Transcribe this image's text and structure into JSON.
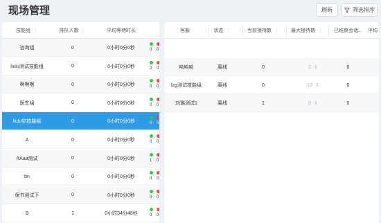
{
  "header": {
    "title": "现场管理",
    "refresh_label": "刷新",
    "filter_label": "筛选排序"
  },
  "left_table": {
    "columns": [
      "技能组",
      "排队人数",
      "平均等待时长"
    ],
    "rows": [
      {
        "name": "咨询组",
        "queue": "0",
        "wait": "0小时0分0秒",
        "online": "0",
        "offline": "0",
        "selected": false
      },
      {
        "name": "liulu测试技能组",
        "queue": "0",
        "wait": "0小时0分0秒",
        "online": "2",
        "offline": "0",
        "selected": false
      },
      {
        "name": "啊啊啊",
        "queue": "0",
        "wait": "0小时0分0秒",
        "online": "0",
        "offline": "0",
        "selected": false
      },
      {
        "name": "医生组",
        "queue": "0",
        "wait": "0小时0分0秒",
        "online": "0",
        "offline": "0",
        "selected": false
      },
      {
        "name": "liulu空技能组",
        "queue": "0",
        "wait": "0小时0分0秒",
        "online": "0",
        "offline": "0",
        "selected": true
      },
      {
        "name": "A",
        "queue": "0",
        "wait": "0小时0分0秒",
        "online": "0",
        "offline": "0",
        "selected": false
      },
      {
        "name": "AAaa测试",
        "queue": "0",
        "wait": "0小时0分0秒",
        "online": "1",
        "offline": "0",
        "selected": false
      },
      {
        "name": "bn",
        "queue": "0",
        "wait": "0小时0分0秒",
        "online": "0",
        "offline": "0",
        "selected": false
      },
      {
        "name": "保书测试下",
        "queue": "0",
        "wait": "0小时0分0秒",
        "online": "0",
        "offline": "0",
        "selected": false
      },
      {
        "name": "B",
        "queue": "1",
        "wait": "0小时34分48秒",
        "online": "0",
        "offline": "0",
        "selected": false
      }
    ]
  },
  "right_table": {
    "columns": [
      "客服",
      "状态",
      "当前接待数",
      "最大接待数",
      "已结束会话...",
      "平均"
    ],
    "rows": [
      {
        "agent": "哈哈哈",
        "status": "离线",
        "current": "0",
        "max": "2",
        "ended": "0"
      },
      {
        "agent": "lzg测试技能组",
        "status": "离线",
        "current": "0",
        "max": "10",
        "ended": "0"
      },
      {
        "agent": "刘璐测试1",
        "status": "离线",
        "current": "1",
        "max": "0",
        "ended": "0"
      }
    ]
  },
  "colors": {
    "selected_row": "#2f9be6",
    "online_dot": "#33c74a",
    "offline_dot": "#f24b3f"
  }
}
